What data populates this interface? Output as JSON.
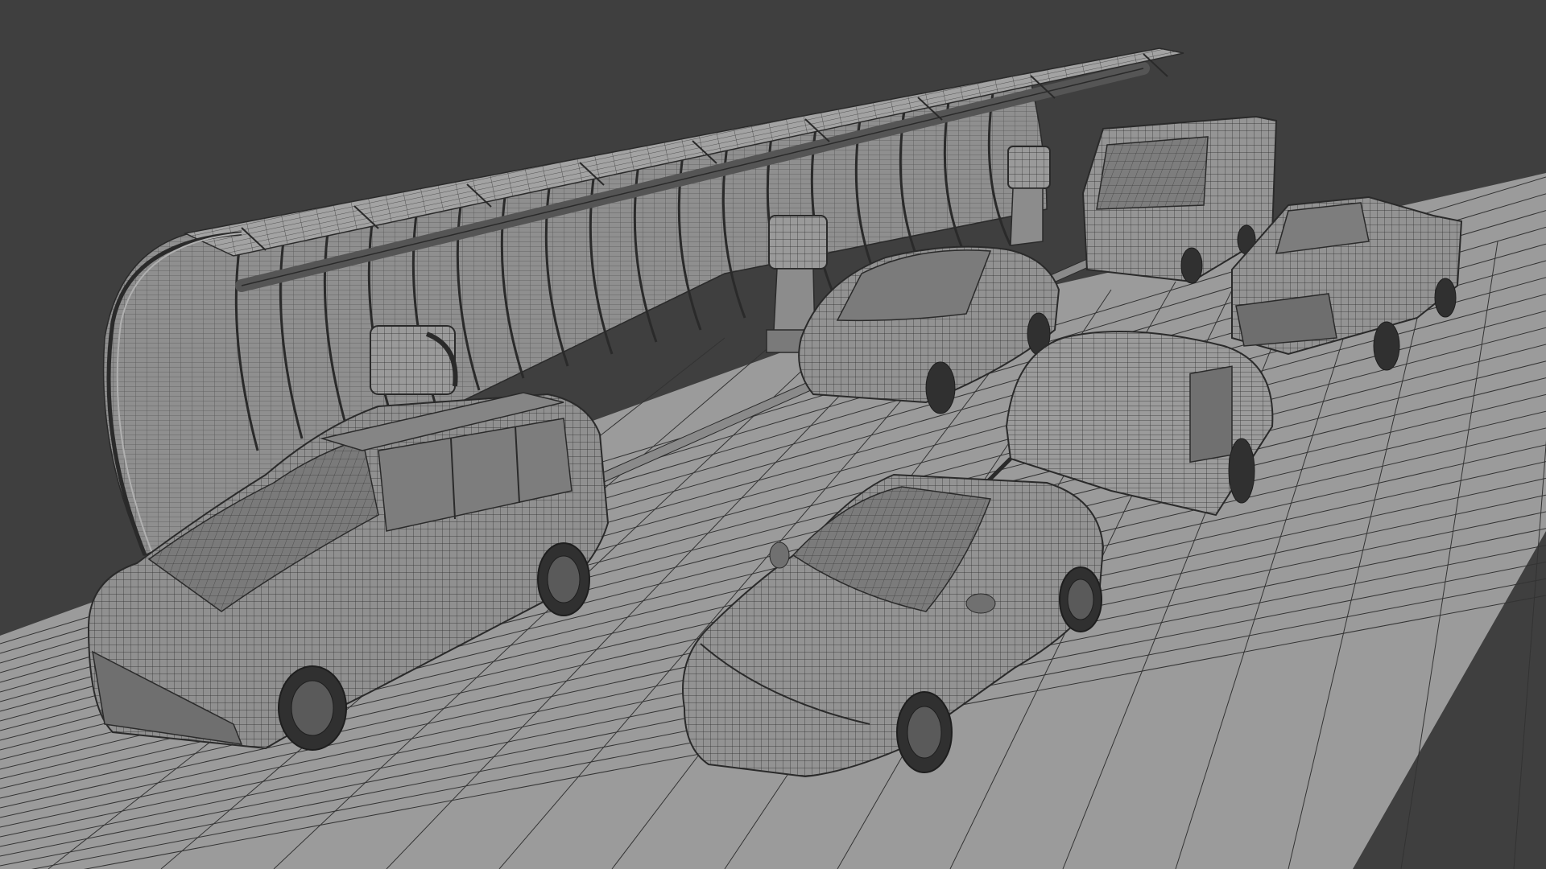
{
  "scene": {
    "colors": {
      "background": "#3f3f3f",
      "ground": "#9a9a9a",
      "wire": "#2a2a2a",
      "body": "#8e8e8e",
      "glass": "#7a7a7a",
      "tire": "#303030",
      "panel": "#a2a2a2"
    },
    "objects": [
      "solar-carport-canopy",
      "ev-charger-left",
      "ev-charger-center",
      "ev-charger-right",
      "minivan",
      "sedan",
      "crossover",
      "teardrop-trailer",
      "box-van",
      "pickup-truck"
    ]
  }
}
